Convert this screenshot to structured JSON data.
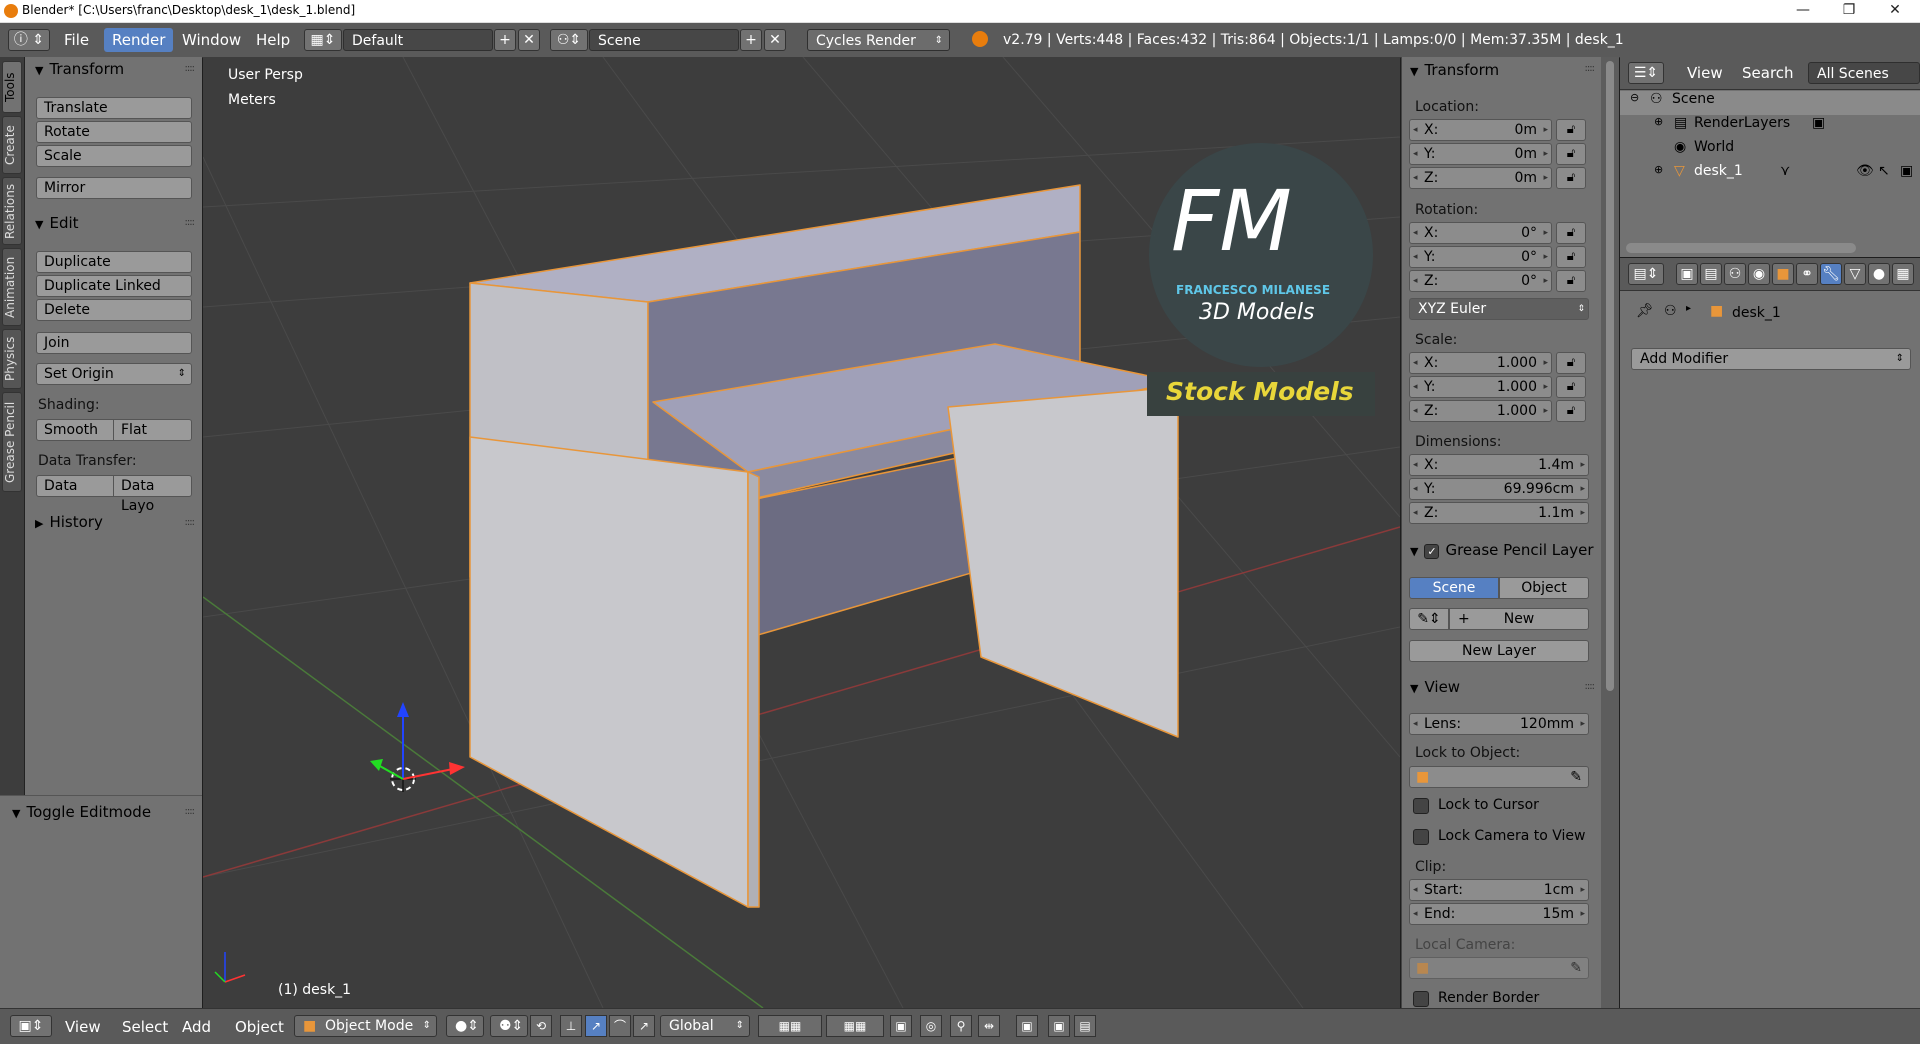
{
  "titlebar": {
    "title": "Blender* [C:\\Users\\franc\\Desktop\\desk_1\\desk_1.blend]",
    "minimize": "—",
    "maximize": "❐",
    "close": "✕"
  },
  "header": {
    "menus": [
      "File",
      "Render",
      "Window",
      "Help"
    ],
    "active_menu": "Render",
    "layout": "Default",
    "scene": "Scene",
    "engine": "Cycles Render",
    "stats": "v2.79 | Verts:448 | Faces:432 | Tris:864 | Objects:1/1 | Lamps:0/0 | Mem:37.35M | desk_1"
  },
  "tabs": [
    "Tools",
    "Create",
    "Relations",
    "Animation",
    "Physics",
    "Grease Pencil"
  ],
  "toolshelf": {
    "transform_title": "Transform",
    "translate": "Translate",
    "rotate": "Rotate",
    "scale": "Scale",
    "mirror": "Mirror",
    "edit_title": "Edit",
    "duplicate": "Duplicate",
    "duplicate_linked": "Duplicate Linked",
    "delete": "Delete",
    "join": "Join",
    "set_origin": "Set Origin",
    "shading_label": "Shading:",
    "smooth": "Smooth",
    "flat": "Flat",
    "data_transfer_label": "Data Transfer:",
    "data": "Data",
    "data_layout": "Data Layo",
    "history_title": "History",
    "toggle_editmode": "Toggle Editmode"
  },
  "viewport": {
    "view_name": "User Persp",
    "units": "Meters",
    "object_label": "(1) desk_1",
    "logo_fm": "FM",
    "logo_author": "FRANCESCO MILANESE",
    "logo_sub": "3D Models",
    "logo_stock": "Stock Models"
  },
  "npanel": {
    "transform_title": "Transform",
    "location_label": "Location:",
    "location": [
      {
        "k": "X:",
        "v": "0m"
      },
      {
        "k": "Y:",
        "v": "0m"
      },
      {
        "k": "Z:",
        "v": "0m"
      }
    ],
    "rotation_label": "Rotation:",
    "rotation": [
      {
        "k": "X:",
        "v": "0°"
      },
      {
        "k": "Y:",
        "v": "0°"
      },
      {
        "k": "Z:",
        "v": "0°"
      }
    ],
    "rotation_mode": "XYZ Euler",
    "scale_label": "Scale:",
    "scale": [
      {
        "k": "X:",
        "v": "1.000"
      },
      {
        "k": "Y:",
        "v": "1.000"
      },
      {
        "k": "Z:",
        "v": "1.000"
      }
    ],
    "dimensions_label": "Dimensions:",
    "dimensions": [
      {
        "k": "X:",
        "v": "1.4m"
      },
      {
        "k": "Y:",
        "v": "69.996cm"
      },
      {
        "k": "Z:",
        "v": "1.1m"
      }
    ],
    "grease_title": "Grease Pencil Layer",
    "scene_btn": "Scene",
    "object_btn": "Object",
    "new_btn": "New",
    "new_layer_btn": "New Layer",
    "view_title": "View",
    "lens_k": "Lens:",
    "lens_v": "120mm",
    "lock_object_label": "Lock to Object:",
    "lock_cursor": "Lock to Cursor",
    "lock_camera": "Lock Camera to View",
    "clip_label": "Clip:",
    "clip_start_k": "Start:",
    "clip_start_v": "1cm",
    "clip_end_k": "End:",
    "clip_end_v": "15m",
    "local_camera_label": "Local Camera:",
    "render_border": "Render Border"
  },
  "outliner": {
    "view": "View",
    "search": "Search",
    "filter": "All Scenes",
    "items": [
      "Scene",
      "RenderLayers",
      "World",
      "desk_1"
    ]
  },
  "properties": {
    "object_name": "desk_1",
    "add_modifier": "Add Modifier"
  },
  "bottombar": {
    "menus": [
      "View",
      "Select",
      "Add",
      "Object"
    ],
    "mode": "Object Mode",
    "orientation": "Global"
  }
}
